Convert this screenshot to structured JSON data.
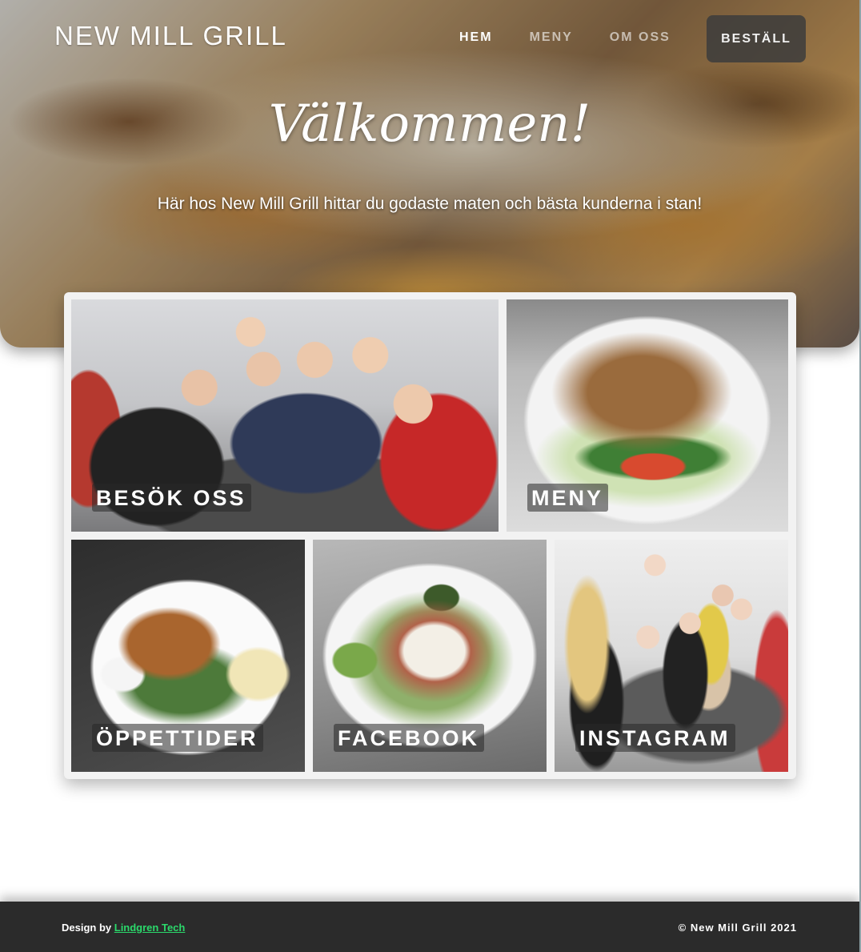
{
  "header": {
    "brand": "NEW MILL GRILL",
    "nav": [
      {
        "label": "HEM",
        "active": true
      },
      {
        "label": "MENY",
        "active": false
      },
      {
        "label": "OM OSS",
        "active": false
      }
    ],
    "order_button": "BESTÄLL"
  },
  "hero": {
    "title": "Välkommen!",
    "tagline": "Här hos New Mill Grill hittar du godaste maten och bästa kunderna i stan!"
  },
  "gallery": {
    "tiles": [
      {
        "label": "BESÖK OSS"
      },
      {
        "label": "MENY"
      },
      {
        "label": "ÖPPETTIDER"
      },
      {
        "label": "FACEBOOK"
      },
      {
        "label": "INSTAGRAM"
      }
    ]
  },
  "footer": {
    "design_prefix": "Design by",
    "design_link": "Lindgren Tech",
    "copyright": "© New Mill Grill 2021"
  },
  "colors": {
    "footer_bg": "#2b2b2b",
    "link": "#2bd96b",
    "order_button_bg": "#3c3c3c"
  }
}
